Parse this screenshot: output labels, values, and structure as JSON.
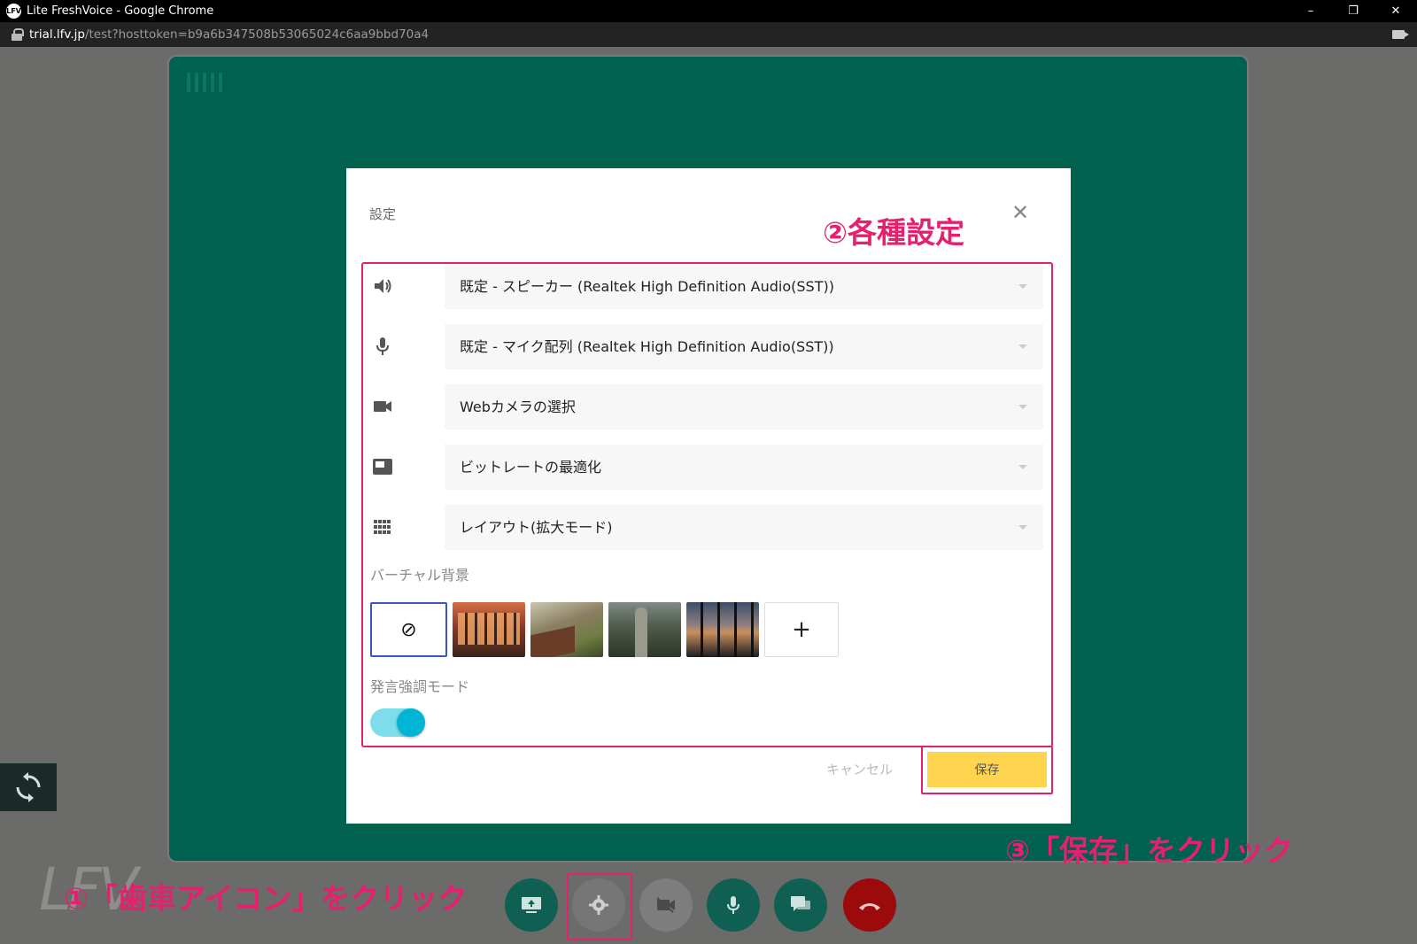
{
  "window": {
    "title": "Lite FreshVoice - Google Chrome",
    "logo": "LFV",
    "controls": [
      "–",
      "❐",
      "✕"
    ]
  },
  "address": {
    "host": "trial.lfv.jp",
    "path": "/test?hosttoken=b9a6b347508b53065024c6aa9bbd70a4"
  },
  "dialog": {
    "title": "設定",
    "close": "✕",
    "rows": [
      {
        "icon": "speaker-icon",
        "value": "既定 - スピーカー (Realtek High Definition Audio(SST))"
      },
      {
        "icon": "microphone-icon",
        "value": "既定 - マイク配列 (Realtek High Definition Audio(SST))"
      },
      {
        "icon": "video-camera-icon",
        "value": "Webカメラの選択"
      },
      {
        "icon": "bitrate-icon",
        "value": "ビットレートの最適化"
      },
      {
        "icon": "grid-layout-icon",
        "value": "レイアウト(拡大モード)"
      }
    ],
    "virtual_bg_label": "バーチャル背景",
    "virtual_bg": {
      "none": "⊘",
      "add": "+",
      "selected": "none"
    },
    "emphasis_label": "発言強調モード",
    "emphasis_on": true,
    "cancel": "キャンセル",
    "save": "保存"
  },
  "annotations": {
    "step1": "①「歯車アイコン」をクリック",
    "step2": "②各種設定",
    "step3": "③「保存」をクリック",
    "watermark": "LFV"
  },
  "colors": {
    "stage": "#00614f",
    "highlight": "#e5216f",
    "save_button": "#ffd550",
    "toggle": "#00b6d4",
    "hangup": "#9c0b0b"
  }
}
